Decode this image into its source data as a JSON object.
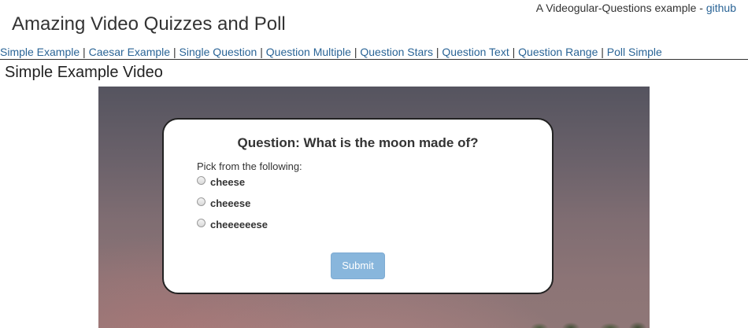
{
  "header": {
    "subtitle_prefix": "A Videogular-Questions example - ",
    "github_link": "github",
    "title": "Amazing Video Quizzes and Poll"
  },
  "nav": {
    "separator": " | ",
    "links": [
      "Simple Example",
      "Caesar Example",
      "Single Question",
      "Question Multiple",
      "Question Stars",
      "Question Text",
      "Question Range",
      "Poll Simple"
    ]
  },
  "video": {
    "title": "Simple Example Video"
  },
  "quiz": {
    "question": "Question: What is the moon made of?",
    "prompt": "Pick from the following:",
    "options": [
      "cheese",
      "cheeese",
      "cheeeeeese"
    ],
    "submit_label": "Submit"
  },
  "colors": {
    "link": "#2a6496",
    "submit_bg": "#88b6dc",
    "text": "#333333"
  }
}
